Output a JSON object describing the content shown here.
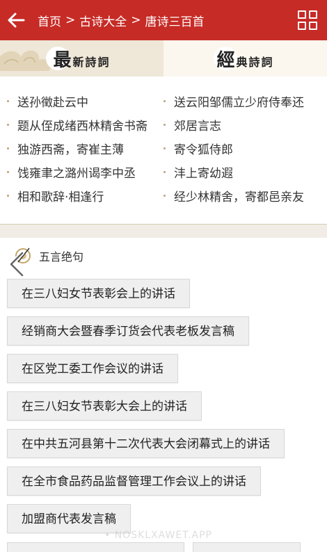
{
  "header": {
    "breadcrumb": [
      "首页",
      "古诗大全",
      "唐诗三百首"
    ],
    "separator": ">",
    "bg_color": "#c62b26"
  },
  "tabs": [
    {
      "big": "最",
      "small": "新詩詞"
    },
    {
      "big": "經",
      "small": "典詩詞"
    }
  ],
  "links": [
    [
      "送孙徵赴云中",
      "送云阳邹儒立少府侍奉还"
    ],
    [
      "题从侄成绪西林精舍书斋",
      "郊居言志"
    ],
    [
      "独游西斋，寄崔主薄",
      "寄令狐侍郎"
    ],
    [
      "饯雍聿之潞州谒李中丞",
      "沣上寄幼遐"
    ],
    [
      "相和歌辞·相逢行",
      "经少林精舍，寄都邑亲友"
    ]
  ],
  "section": {
    "title": "五言绝句"
  },
  "chips": [
    "在三八妇女节表彰会上的讲话",
    "经销商大会暨春季订货会代表老板发言稿",
    "在区党工委工作会议的讲话",
    "在三八妇女节表彰大会上的讲话",
    "在中共五河县第十二次代表大会闭幕式上的讲话",
    "在全市食品药品监督管理工作会议上的讲话",
    "加盟商代表发言稿"
  ],
  "watermark": "• NOSKLXAWET.APP"
}
